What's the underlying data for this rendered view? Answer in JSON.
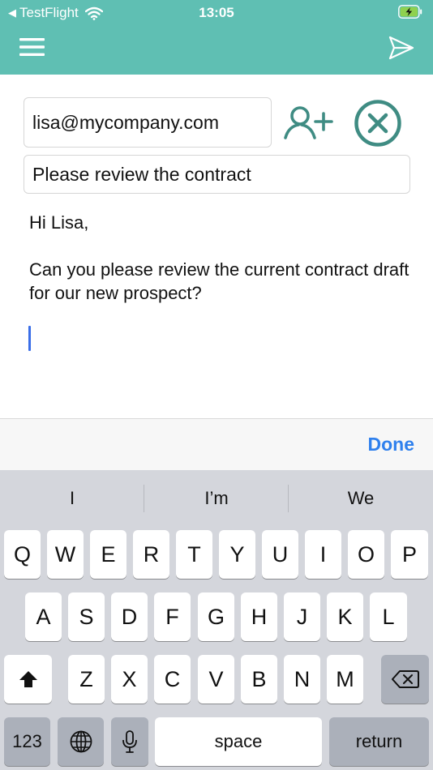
{
  "status_bar": {
    "back_app": "TestFlight",
    "time": "13:05"
  },
  "icons": {
    "menu": "hamburger-menu-icon",
    "send": "paper-plane-send-icon",
    "add_contact": "add-person-icon",
    "clear": "circle-x-icon",
    "wifi": "wifi-icon",
    "battery": "battery-charging-icon",
    "shift": "shift-arrow-icon",
    "delete": "backspace-icon",
    "globe": "globe-icon",
    "mic": "microphone-icon"
  },
  "colors": {
    "header": "#5fbfb3",
    "accent_icon": "#3f8c83",
    "done": "#2f80ed",
    "cursor": "#3a6ee8"
  },
  "compose": {
    "to": "lisa@mycompany.com",
    "subject": "Please review the contract",
    "body": "Hi Lisa,\n\nCan you please review the current contract draft for our new prospect?"
  },
  "accessory": {
    "done_label": "Done"
  },
  "keyboard": {
    "suggestions": [
      "I",
      "I’m",
      "We"
    ],
    "row1": [
      "Q",
      "W",
      "E",
      "R",
      "T",
      "Y",
      "U",
      "I",
      "O",
      "P"
    ],
    "row2": [
      "A",
      "S",
      "D",
      "F",
      "G",
      "H",
      "J",
      "K",
      "L"
    ],
    "row3": [
      "Z",
      "X",
      "C",
      "V",
      "B",
      "N",
      "M"
    ],
    "numbers_label": "123",
    "space_label": "space",
    "return_label": "return"
  }
}
